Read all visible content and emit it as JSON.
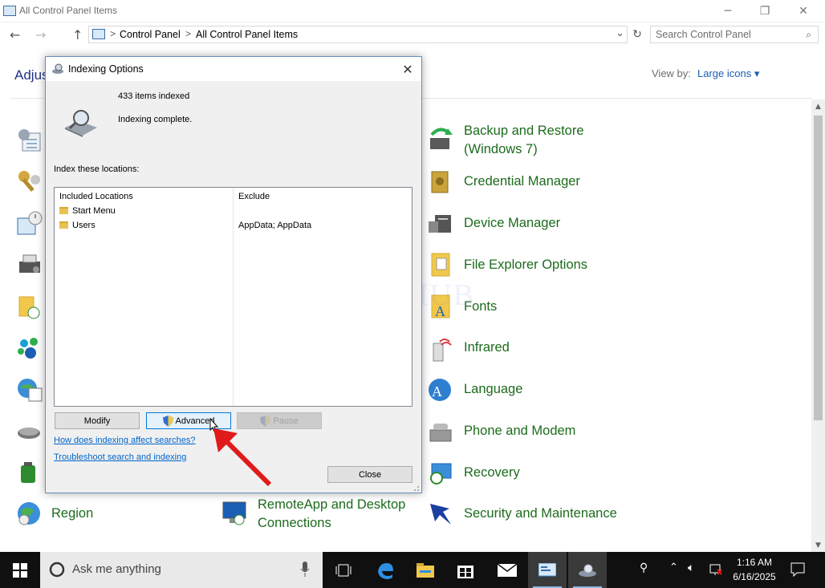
{
  "window": {
    "title": "All Control Panel Items",
    "minimize": "─",
    "maximize": "❐",
    "close": "✕"
  },
  "nav": {
    "back": "←",
    "forward": "→",
    "up": "↑",
    "breadcrumb": [
      "Control Panel",
      "All Control Panel Items"
    ],
    "separator": ">",
    "dropdown": "⌄",
    "refresh": "↻",
    "search_placeholder": "Search Control Panel",
    "search_icon": "⌕"
  },
  "content": {
    "heading": "Adjus",
    "view_by_label": "View by:",
    "view_by_value": "Large icons ▾"
  },
  "items_col2": [
    {
      "label": "Backup and Restore (Windows 7)",
      "icon": "backup-restore-icon"
    },
    {
      "label": "Credential Manager",
      "icon": "credential-manager-icon"
    },
    {
      "label": "Device Manager",
      "icon": "device-manager-icon"
    },
    {
      "label": "File Explorer Options",
      "icon": "file-explorer-options-icon"
    },
    {
      "label": "Fonts",
      "icon": "fonts-icon"
    },
    {
      "label": "Infrared",
      "icon": "infrared-icon"
    },
    {
      "label": "Language",
      "icon": "language-icon"
    },
    {
      "label": "Phone and Modem",
      "icon": "phone-modem-icon"
    },
    {
      "label": "Recovery",
      "icon": "recovery-icon"
    },
    {
      "label": "Security and Maintenance",
      "icon": "security-maintenance-icon"
    }
  ],
  "bottom_row": {
    "region": "Region",
    "remoteapp": "RemoteApp and Desktop Connections"
  },
  "dialog": {
    "title": "Indexing Options",
    "close": "✕",
    "items_indexed": "433 items indexed",
    "status": "Indexing complete.",
    "index_label": "Index these locations:",
    "col_included": "Included Locations",
    "col_exclude": "Exclude",
    "locations": [
      {
        "name": "Start Menu",
        "exclude": ""
      },
      {
        "name": "Users",
        "exclude": "AppData; AppData"
      }
    ],
    "btn_modify": "Modify",
    "btn_advanced": "Advanced",
    "btn_pause": "Pause",
    "link_how": "How does indexing affect searches?",
    "link_troubleshoot": "Troubleshoot search and indexing",
    "btn_close": "Close"
  },
  "watermark": "IT Pros HUB",
  "taskbar": {
    "search_text": "Ask me anything",
    "time": "1:16 AM",
    "date": "6/16/2025"
  },
  "colors": {
    "link_green": "#1c6b1c",
    "taskbar": "#101010",
    "arrow": "#e01b1b"
  }
}
